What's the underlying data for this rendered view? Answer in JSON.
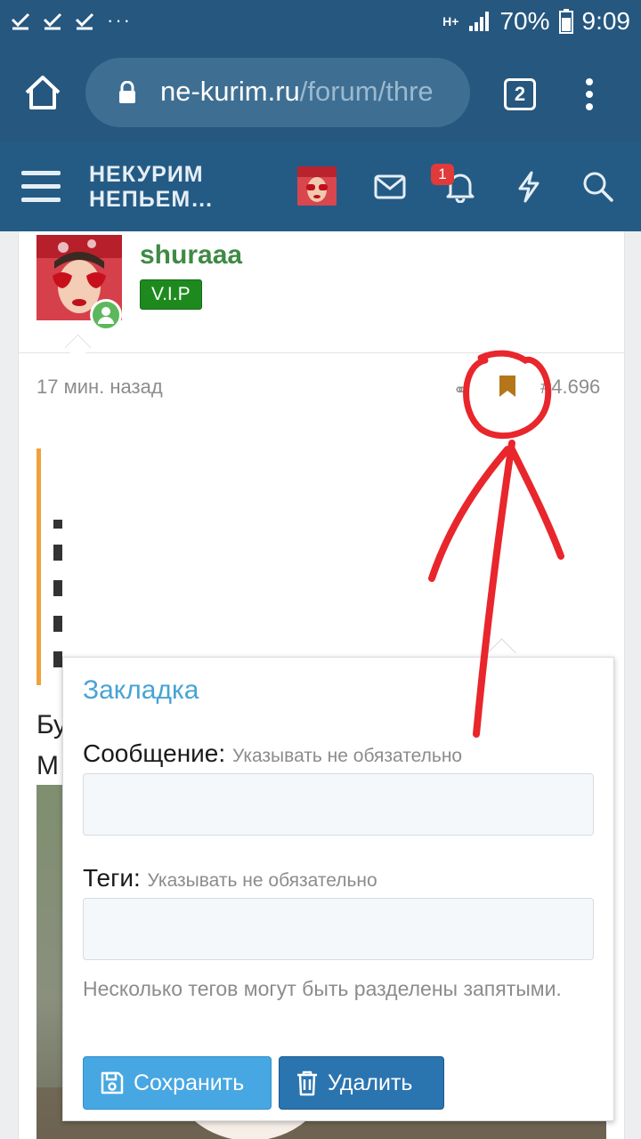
{
  "status_bar": {
    "network": "H+",
    "battery": "70%",
    "time": "9:09"
  },
  "browser": {
    "url_domain": "ne-kurim.ru",
    "url_path": "/forum/thre",
    "tab_count": "2"
  },
  "site_header": {
    "logo_line1": "НЕКУРИМ",
    "logo_line2": "НЕПЬЕМ…",
    "notification_count": "1"
  },
  "post": {
    "username": "shuraaa",
    "badge": "V.I.P",
    "time": "17 мин. назад",
    "number": "#4.696",
    "text_line1": "Бу",
    "text_line2": "М"
  },
  "bookmark_popup": {
    "title": "Закладка",
    "message_label": "Сообщение:",
    "message_hint": "Указывать не обязательно",
    "tags_label": "Теги:",
    "tags_hint": "Указывать не обязательно",
    "tags_explain": "Несколько тегов могут быть разделены запятыми.",
    "save_label": "Сохранить",
    "delete_label": "Удалить"
  },
  "colors": {
    "header_bg": "#245b85",
    "browser_bg": "#25577f",
    "username": "#3f8a45",
    "vip": "#1e8a1e",
    "popup_title": "#47a3d6",
    "save_button": "#47a7e2",
    "delete_button": "#2a74b0",
    "bookmark_icon": "#b5761a",
    "annotation": "#e8262c"
  }
}
